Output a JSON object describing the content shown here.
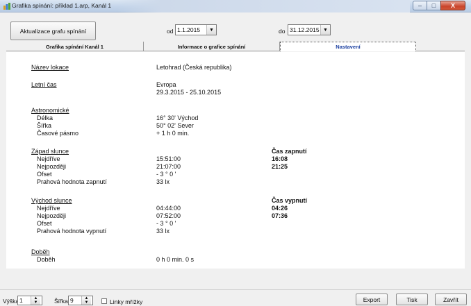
{
  "window": {
    "title": "Grafika spínání: příklad 1.arp, Kanál 1",
    "controls": {
      "minimize": "–",
      "maximize": "□",
      "close": "X"
    }
  },
  "toolbar": {
    "refresh_label": "Aktualizace grafu spínání",
    "from_label": "od",
    "from_value": "1.1.2015",
    "to_label": "do",
    "to_value": "31.12.2015",
    "dropdown_glyph": "▼"
  },
  "tabs": [
    {
      "label": "Grafika spínání Kanál 1"
    },
    {
      "label": "Informace o grafice spínání"
    },
    {
      "label": "Nastavení"
    }
  ],
  "settings": {
    "location": {
      "label": "Název lokace",
      "value": "Letohrad (Česká republika)"
    },
    "dst": {
      "label": "Letní čas",
      "value1": "Evropa",
      "value2": "29.3.2015 - 25.10.2015"
    },
    "astro": {
      "label": "Astronomické",
      "longitude_label": "Délka",
      "longitude_value": "16° 30'  Východ",
      "latitude_label": "Šířka",
      "latitude_value": "50° 02'  Sever",
      "tz_label": "Časové pásmo",
      "tz_value": "+ 1 h 0 min."
    },
    "sunset": {
      "label": "Západ slunce",
      "earliest_label": "Nejdříve",
      "earliest_value": "15:51:00",
      "latest_label": "Nejpozději",
      "latest_value": "21:07:00",
      "offset_label": "Ofset",
      "offset_value": "- 3 ° 0 '",
      "threshold_label": "Prahová hodnota zapnutí",
      "threshold_value": "33 lx",
      "time_header": "Čas zapnutí",
      "time_earliest": "16:08",
      "time_latest": "21:25"
    },
    "sunrise": {
      "label": "Východ slunce",
      "earliest_label": "Nejdříve",
      "earliest_value": "04:44:00",
      "latest_label": "Nejpozději",
      "latest_value": "07:52:00",
      "offset_label": "Ofset",
      "offset_value": "- 3 ° 0 '",
      "threshold_label": "Prahová hodnota vypnutí",
      "threshold_value": "33 lx",
      "time_header": "Čas vypnutí",
      "time_earliest": "04:26",
      "time_latest": "07:36"
    },
    "overrun": {
      "label": "Doběh",
      "item_label": "Doběh",
      "item_value": "0 h 0 min. 0 s"
    }
  },
  "bottom": {
    "height_label": "Výška",
    "height_value": "1",
    "width_label": "Šířka",
    "width_value": "9",
    "grid_label": "Linky mřížky",
    "export_label": "Export",
    "print_label": "Tisk",
    "close_label": "Zavřít"
  },
  "colors": {
    "active_tab_text": "#1a3fa0",
    "titlebar": "#c4d5ea",
    "close_button": "#c9452b"
  }
}
